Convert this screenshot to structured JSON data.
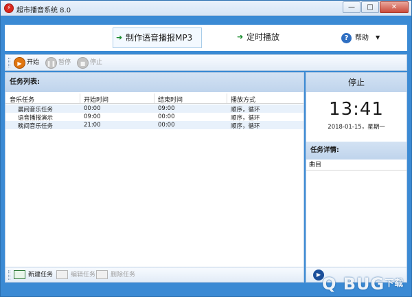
{
  "window": {
    "title": "超市播音系统 8.0",
    "app_icon": "app-logo-icon",
    "controls": {
      "minimize": "—",
      "maximize": "□",
      "close": "✕"
    }
  },
  "header": {
    "make_mp3": "制作语音播报MP3",
    "scheduled_play": "定时播放",
    "help": "帮助"
  },
  "toolbar": {
    "start": "开始",
    "pause": "暂停",
    "stop": "停止"
  },
  "task_list": {
    "title": "任务列表:",
    "columns": [
      "音乐任务",
      "开始时间",
      "结束时间",
      "播放方式"
    ],
    "rows": [
      [
        "晨间音乐任务",
        "00:00",
        "09:00",
        "顺序，循环"
      ],
      [
        "语音播报演示",
        "09:00",
        "00:00",
        "顺序，循环"
      ],
      [
        "晚间音乐任务",
        "21:00",
        "00:00",
        "顺序，循环"
      ]
    ],
    "footer": {
      "new_task": "新建任务",
      "edit_task": "编辑任务",
      "delete_task": "删除任务"
    }
  },
  "status_panel": {
    "state": "停止",
    "clock": "13:41",
    "date": "2018-01-15，星期一",
    "detail_title": "任务详情:",
    "detail_column": "曲目"
  },
  "watermark": {
    "main": "Q BUG",
    "sub": "下载"
  },
  "colors": {
    "frame_blue": "#3b8ad4",
    "panel_header": "#c9dbf0",
    "row_alt": "#e8f1fb",
    "play_orange": "#e07610",
    "arrow_green": "#1a8c2e"
  }
}
